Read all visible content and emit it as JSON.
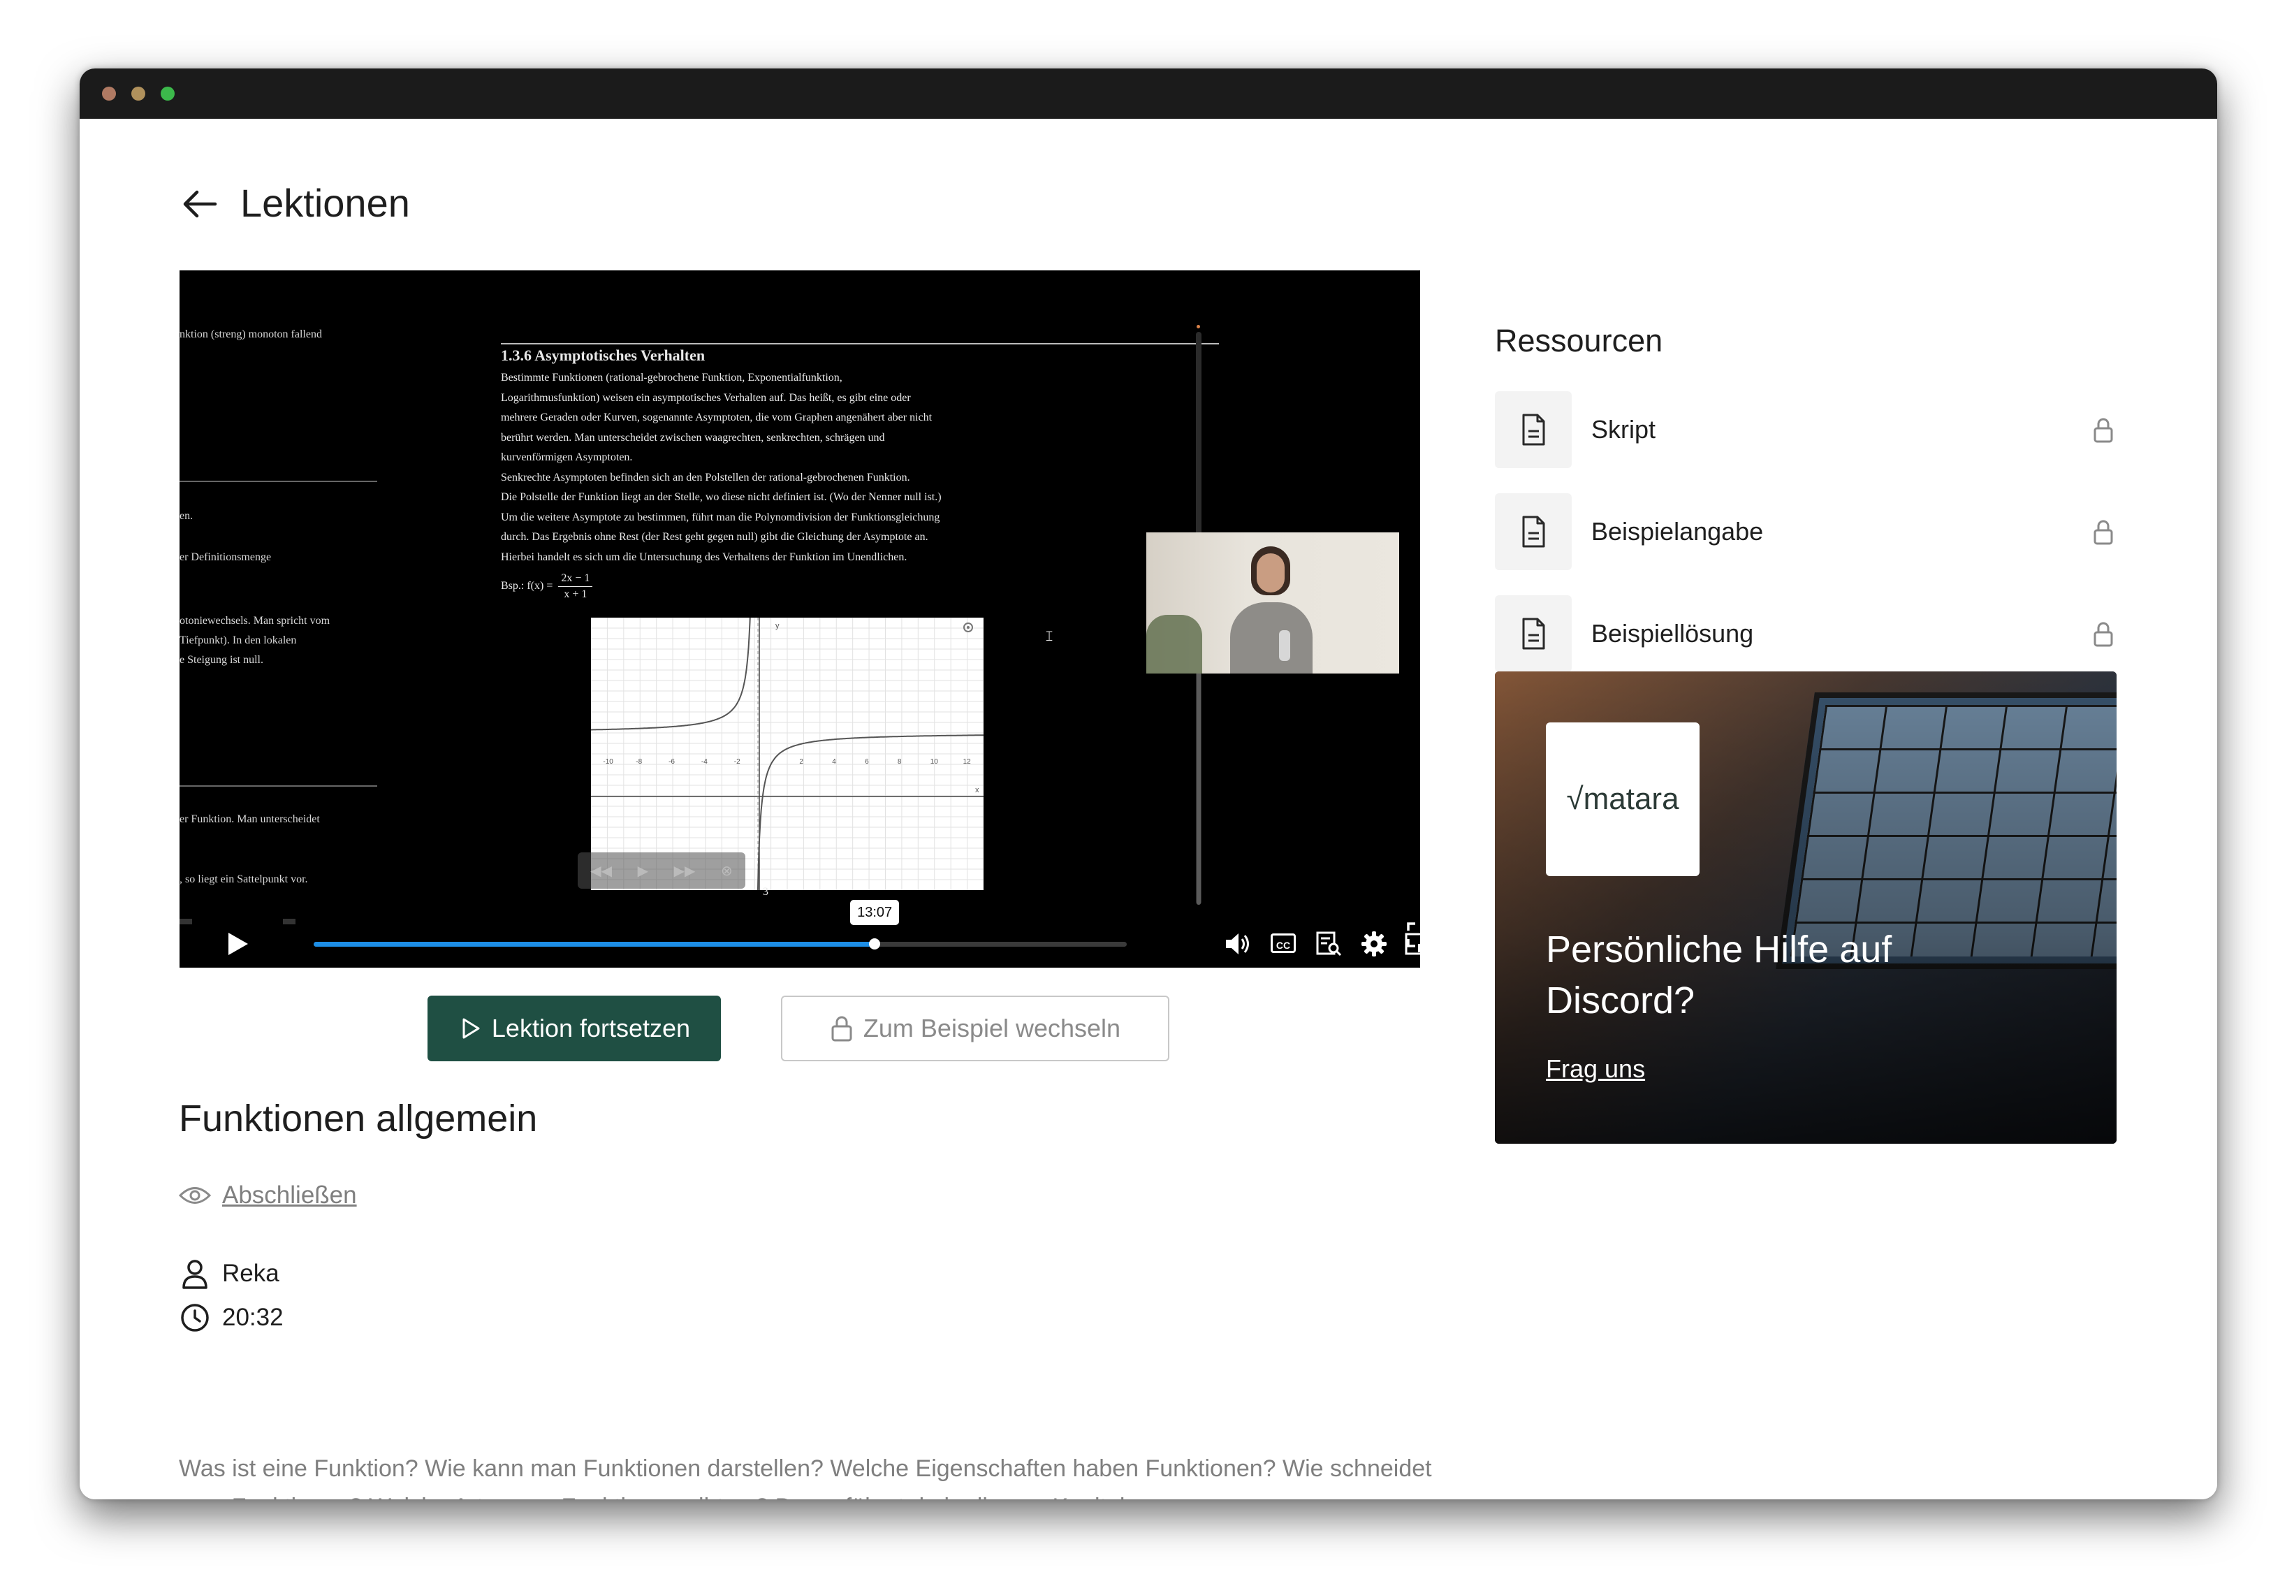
{
  "window": {
    "dot_colors": [
      "#b07a63",
      "#b0915c",
      "#3cb94b"
    ]
  },
  "header": {
    "back_icon": "arrow-left-icon",
    "title": "Lektionen"
  },
  "video": {
    "slide": {
      "heading": "1.3.6 Asymptotisches Verhalten",
      "lines": [
        "Bestimmte Funktionen (rational-gebrochene Funktion, Exponentialfunktion,",
        "Logarithmusfunktion) weisen ein asymptotisches Verhalten auf. Das heißt, es gibt eine oder",
        "mehrere Geraden oder Kurven, sogenannte Asymptoten, die vom Graphen angenähert aber nicht",
        "berührt werden. Man unterscheidet zwischen waagrechten, senkrechten, schrägen und",
        "kurvenförmigen Asymptoten.",
        "Senkrechte Asymptoten befinden sich an den Polstellen der rational-gebrochenen Funktion.",
        "Die Polstelle der Funktion liegt an der Stelle, wo diese nicht definiert ist. (Wo der Nenner null ist.)",
        "Um die weitere Asymptote zu bestimmen, führt man die Polynomdivision der Funktionsgleichung",
        "durch. Das Ergebnis ohne Rest (der Rest geht gegen null) gibt die Gleichung der Asymptote an.",
        "Hierbei handelt es sich um die Untersuchung des Verhaltens der Funktion im Unendlichen."
      ],
      "example_prefix": "Bsp.: f(x) =",
      "example_numerator": "2x − 1",
      "example_denominator": "x + 1",
      "left_fragments": [
        "nktion (streng) monoton fallend",
        "en.",
        "er Definitionsmenge",
        "otoniewechsels. Man spricht vom",
        "Tiefpunkt). In den lokalen",
        "e Steigung ist null.",
        "er Funktion. Man unterscheidet",
        ", so liegt ein Sattelpunkt vor."
      ],
      "graph_x_ticks": [
        "-10",
        "-8",
        "-6",
        "-4",
        "-2",
        "2",
        "4",
        "6",
        "8",
        "10",
        "12"
      ],
      "graph_axis_x": "x",
      "graph_axis_y": "y",
      "graph_tick_below": "3"
    },
    "progress": 0.69,
    "time_tooltip": "13:07",
    "controls": {
      "play_icon": "play-icon",
      "volume_icon": "volume-icon",
      "captions_label": "CC",
      "transcript_icon": "transcript-icon",
      "settings_icon": "gear-icon",
      "pip_icon": "picture-in-picture-icon",
      "fullscreen_icon": "fullscreen-icon"
    },
    "accent_color": "#1d8ee6"
  },
  "actions": {
    "continue_label": "Lektion fortsetzen",
    "switch_label": "Zum Beispiel wechseln"
  },
  "lesson": {
    "title": "Funktionen allgemein",
    "complete_label": "Abschließen",
    "author": "Reka",
    "duration": "20:32",
    "description": "Was ist eine Funktion? Wie kann man Funktionen darstellen? Welche Eigenschaften haben Funktionen? Wie schneidet man Funktionen? Welche Arten von Funktionen gibt es? Das erfährst du in diesem Kapitel."
  },
  "resources": {
    "title": "Ressourcen",
    "items": [
      {
        "label": "Skript",
        "icon": "document-icon",
        "locked": true
      },
      {
        "label": "Beispielangabe",
        "icon": "document-icon",
        "locked": true
      },
      {
        "label": "Beispiellösung",
        "icon": "document-icon",
        "locked": true
      }
    ]
  },
  "promo": {
    "logo_text": "√matara",
    "title": "Persönliche Hilfe auf Discord?",
    "link_label": "Frag uns"
  },
  "colors": {
    "primary": "#1f4f43",
    "text": "#1e1e1e",
    "muted": "#7f7f7f"
  }
}
